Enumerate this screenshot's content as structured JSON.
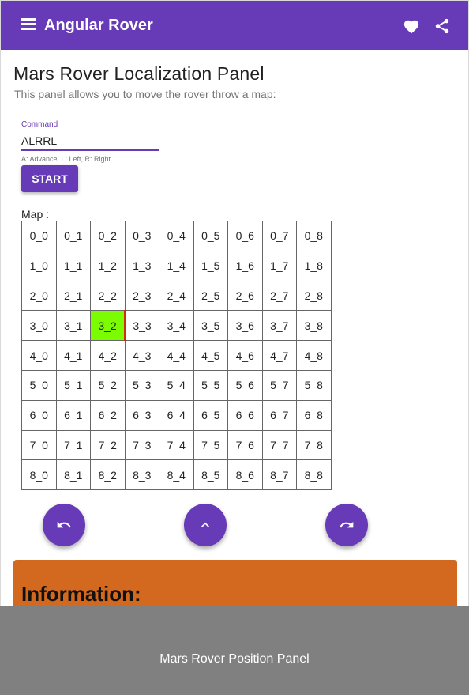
{
  "app": {
    "title": "Angular Rover"
  },
  "icons": {
    "menu": "menu-icon",
    "favorite": "heart-icon",
    "share": "share-icon",
    "turn_left": "turn-left-icon",
    "advance": "chevron-up-icon",
    "turn_right": "turn-right-icon"
  },
  "page": {
    "title": "Mars Rover Localization Panel",
    "subtitle": "This panel allows you to move the rover throw a map:"
  },
  "command": {
    "label": "Command",
    "value": "ALRRL",
    "hint": "A: Advance, L: Left, R: Right"
  },
  "start_button": "START",
  "map": {
    "label": "Map :",
    "rover_cell": "3_2",
    "rover_color": "#7cfc00",
    "rows": [
      [
        "0_0",
        "0_1",
        "0_2",
        "0_3",
        "0_4",
        "0_5",
        "0_6",
        "0_7",
        "0_8"
      ],
      [
        "1_0",
        "1_1",
        "1_2",
        "1_3",
        "1_4",
        "1_5",
        "1_6",
        "1_7",
        "1_8"
      ],
      [
        "2_0",
        "2_1",
        "2_2",
        "2_3",
        "2_4",
        "2_5",
        "2_6",
        "2_7",
        "2_8"
      ],
      [
        "3_0",
        "3_1",
        "3_2",
        "3_3",
        "3_4",
        "3_5",
        "3_6",
        "3_7",
        "3_8"
      ],
      [
        "4_0",
        "4_1",
        "4_2",
        "4_3",
        "4_4",
        "4_5",
        "4_6",
        "4_7",
        "4_8"
      ],
      [
        "5_0",
        "5_1",
        "5_2",
        "5_3",
        "5_4",
        "5_5",
        "5_6",
        "5_7",
        "5_8"
      ],
      [
        "6_0",
        "6_1",
        "6_2",
        "6_3",
        "6_4",
        "6_5",
        "6_6",
        "6_7",
        "6_8"
      ],
      [
        "7_0",
        "7_1",
        "7_2",
        "7_3",
        "7_4",
        "7_5",
        "7_6",
        "7_7",
        "7_8"
      ],
      [
        "8_0",
        "8_1",
        "8_2",
        "8_3",
        "8_4",
        "8_5",
        "8_6",
        "8_7",
        "8_8"
      ]
    ]
  },
  "info": {
    "title": "Information:"
  },
  "footer": {
    "text": "Mars Rover Position Panel"
  },
  "colors": {
    "primary": "#673ab7",
    "info_card": "#d2691e",
    "footer": "#808080"
  }
}
